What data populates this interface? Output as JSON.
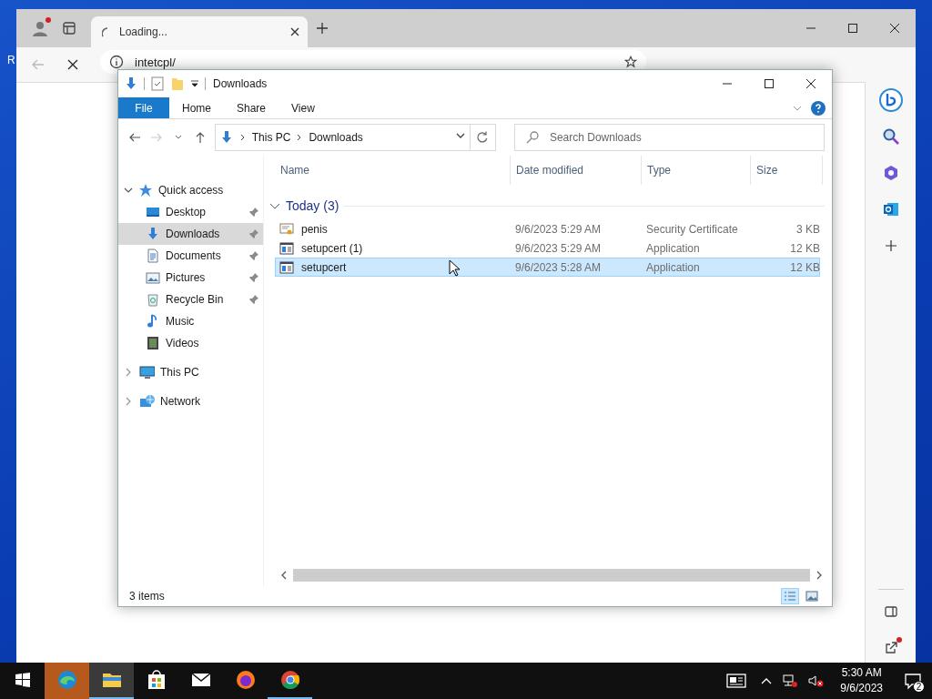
{
  "desktop": {
    "edge_text": "R"
  },
  "browser": {
    "tab_title": "Loading...",
    "address": "intetcpl/"
  },
  "explorer": {
    "title": "Downloads",
    "file_tab": "File",
    "ribbon_tabs": [
      "Home",
      "Share",
      "View"
    ],
    "breadcrumb": [
      "This PC",
      "Downloads"
    ],
    "search": {
      "placeholder": "Search Downloads"
    },
    "nav": [
      {
        "label": "Quick access",
        "kind": "star",
        "expanded": true,
        "children": [
          {
            "label": "Desktop",
            "kind": "desktop",
            "pinned": true,
            "selected": false
          },
          {
            "label": "Downloads",
            "kind": "download",
            "pinned": true,
            "selected": true
          },
          {
            "label": "Documents",
            "kind": "document",
            "pinned": true,
            "selected": false
          },
          {
            "label": "Pictures",
            "kind": "pictures",
            "pinned": true,
            "selected": false
          },
          {
            "label": "Recycle Bin",
            "kind": "recycle",
            "pinned": true,
            "selected": false
          },
          {
            "label": "Music",
            "kind": "music",
            "pinned": false,
            "selected": false
          },
          {
            "label": "Videos",
            "kind": "videos",
            "pinned": false,
            "selected": false
          }
        ]
      },
      {
        "label": "This PC",
        "kind": "pc",
        "expanded": false
      },
      {
        "label": "Network",
        "kind": "network",
        "expanded": false
      }
    ],
    "columns": [
      "Name",
      "Date modified",
      "Type",
      "Size"
    ],
    "group": {
      "label": "Today (3)",
      "expanded": true
    },
    "files": [
      {
        "name": "penis",
        "date": "9/6/2023 5:29 AM",
        "type": "Security Certificate",
        "size": "3 KB",
        "kind": "certificate",
        "selected": false
      },
      {
        "name": "setupcert (1)",
        "date": "9/6/2023 5:29 AM",
        "type": "Application",
        "size": "12 KB",
        "kind": "application",
        "selected": false
      },
      {
        "name": "setupcert",
        "date": "9/6/2023 5:28 AM",
        "type": "Application",
        "size": "12 KB",
        "kind": "application",
        "selected": true
      }
    ],
    "status": "3 items"
  },
  "taskbar": {
    "apps": [
      {
        "kind": "edge",
        "flashing": true,
        "selected": false,
        "running": false
      },
      {
        "kind": "explorer",
        "flashing": false,
        "selected": true,
        "running": true
      },
      {
        "kind": "store",
        "flashing": false,
        "selected": false,
        "running": false
      },
      {
        "kind": "mail",
        "flashing": false,
        "selected": false,
        "running": false
      },
      {
        "kind": "firefox",
        "flashing": false,
        "selected": false,
        "running": false
      },
      {
        "kind": "chrome",
        "flashing": false,
        "selected": false,
        "running": true
      }
    ],
    "time": "5:30 AM",
    "date": "9/6/2023",
    "notifications": "2"
  }
}
